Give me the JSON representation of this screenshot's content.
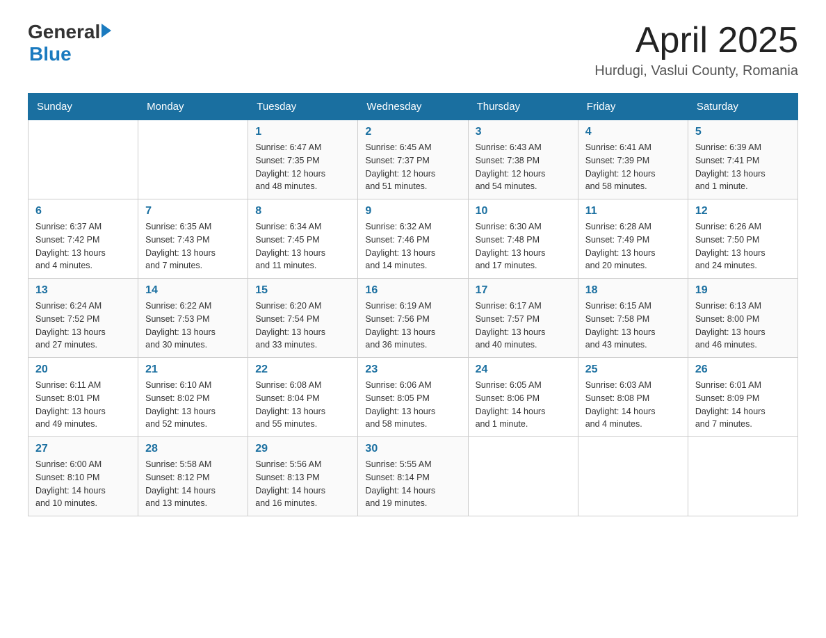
{
  "header": {
    "logo_general": "General",
    "logo_blue": "Blue",
    "title": "April 2025",
    "subtitle": "Hurdugi, Vaslui County, Romania"
  },
  "days_of_week": [
    "Sunday",
    "Monday",
    "Tuesday",
    "Wednesday",
    "Thursday",
    "Friday",
    "Saturday"
  ],
  "weeks": [
    [
      {
        "day": "",
        "info": ""
      },
      {
        "day": "",
        "info": ""
      },
      {
        "day": "1",
        "info": "Sunrise: 6:47 AM\nSunset: 7:35 PM\nDaylight: 12 hours\nand 48 minutes."
      },
      {
        "day": "2",
        "info": "Sunrise: 6:45 AM\nSunset: 7:37 PM\nDaylight: 12 hours\nand 51 minutes."
      },
      {
        "day": "3",
        "info": "Sunrise: 6:43 AM\nSunset: 7:38 PM\nDaylight: 12 hours\nand 54 minutes."
      },
      {
        "day": "4",
        "info": "Sunrise: 6:41 AM\nSunset: 7:39 PM\nDaylight: 12 hours\nand 58 minutes."
      },
      {
        "day": "5",
        "info": "Sunrise: 6:39 AM\nSunset: 7:41 PM\nDaylight: 13 hours\nand 1 minute."
      }
    ],
    [
      {
        "day": "6",
        "info": "Sunrise: 6:37 AM\nSunset: 7:42 PM\nDaylight: 13 hours\nand 4 minutes."
      },
      {
        "day": "7",
        "info": "Sunrise: 6:35 AM\nSunset: 7:43 PM\nDaylight: 13 hours\nand 7 minutes."
      },
      {
        "day": "8",
        "info": "Sunrise: 6:34 AM\nSunset: 7:45 PM\nDaylight: 13 hours\nand 11 minutes."
      },
      {
        "day": "9",
        "info": "Sunrise: 6:32 AM\nSunset: 7:46 PM\nDaylight: 13 hours\nand 14 minutes."
      },
      {
        "day": "10",
        "info": "Sunrise: 6:30 AM\nSunset: 7:48 PM\nDaylight: 13 hours\nand 17 minutes."
      },
      {
        "day": "11",
        "info": "Sunrise: 6:28 AM\nSunset: 7:49 PM\nDaylight: 13 hours\nand 20 minutes."
      },
      {
        "day": "12",
        "info": "Sunrise: 6:26 AM\nSunset: 7:50 PM\nDaylight: 13 hours\nand 24 minutes."
      }
    ],
    [
      {
        "day": "13",
        "info": "Sunrise: 6:24 AM\nSunset: 7:52 PM\nDaylight: 13 hours\nand 27 minutes."
      },
      {
        "day": "14",
        "info": "Sunrise: 6:22 AM\nSunset: 7:53 PM\nDaylight: 13 hours\nand 30 minutes."
      },
      {
        "day": "15",
        "info": "Sunrise: 6:20 AM\nSunset: 7:54 PM\nDaylight: 13 hours\nand 33 minutes."
      },
      {
        "day": "16",
        "info": "Sunrise: 6:19 AM\nSunset: 7:56 PM\nDaylight: 13 hours\nand 36 minutes."
      },
      {
        "day": "17",
        "info": "Sunrise: 6:17 AM\nSunset: 7:57 PM\nDaylight: 13 hours\nand 40 minutes."
      },
      {
        "day": "18",
        "info": "Sunrise: 6:15 AM\nSunset: 7:58 PM\nDaylight: 13 hours\nand 43 minutes."
      },
      {
        "day": "19",
        "info": "Sunrise: 6:13 AM\nSunset: 8:00 PM\nDaylight: 13 hours\nand 46 minutes."
      }
    ],
    [
      {
        "day": "20",
        "info": "Sunrise: 6:11 AM\nSunset: 8:01 PM\nDaylight: 13 hours\nand 49 minutes."
      },
      {
        "day": "21",
        "info": "Sunrise: 6:10 AM\nSunset: 8:02 PM\nDaylight: 13 hours\nand 52 minutes."
      },
      {
        "day": "22",
        "info": "Sunrise: 6:08 AM\nSunset: 8:04 PM\nDaylight: 13 hours\nand 55 minutes."
      },
      {
        "day": "23",
        "info": "Sunrise: 6:06 AM\nSunset: 8:05 PM\nDaylight: 13 hours\nand 58 minutes."
      },
      {
        "day": "24",
        "info": "Sunrise: 6:05 AM\nSunset: 8:06 PM\nDaylight: 14 hours\nand 1 minute."
      },
      {
        "day": "25",
        "info": "Sunrise: 6:03 AM\nSunset: 8:08 PM\nDaylight: 14 hours\nand 4 minutes."
      },
      {
        "day": "26",
        "info": "Sunrise: 6:01 AM\nSunset: 8:09 PM\nDaylight: 14 hours\nand 7 minutes."
      }
    ],
    [
      {
        "day": "27",
        "info": "Sunrise: 6:00 AM\nSunset: 8:10 PM\nDaylight: 14 hours\nand 10 minutes."
      },
      {
        "day": "28",
        "info": "Sunrise: 5:58 AM\nSunset: 8:12 PM\nDaylight: 14 hours\nand 13 minutes."
      },
      {
        "day": "29",
        "info": "Sunrise: 5:56 AM\nSunset: 8:13 PM\nDaylight: 14 hours\nand 16 minutes."
      },
      {
        "day": "30",
        "info": "Sunrise: 5:55 AM\nSunset: 8:14 PM\nDaylight: 14 hours\nand 19 minutes."
      },
      {
        "day": "",
        "info": ""
      },
      {
        "day": "",
        "info": ""
      },
      {
        "day": "",
        "info": ""
      }
    ]
  ]
}
